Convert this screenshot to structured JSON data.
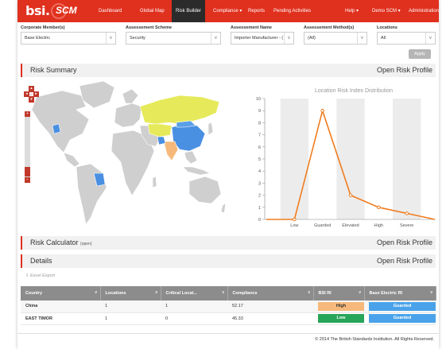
{
  "nav": {
    "logo": "bsi.",
    "product": "SCM",
    "items": [
      "Dashboard",
      "Global Map",
      "Risk Builder",
      "Compliance ▾",
      "Reports",
      "Pending Activities"
    ],
    "right_items": [
      "Help ▾",
      "Demo SCM ▾",
      "Administration ▾"
    ]
  },
  "filters": [
    {
      "label": "Corporate Member(s)",
      "value": "Base Electric"
    },
    {
      "label": "Assessement Scheme",
      "value": "Security"
    },
    {
      "label": "Assessement Name",
      "value": "Importer Manufacturer - ("
    },
    {
      "label": "Assessement Method(s)",
      "value": "(All)"
    },
    {
      "label": "Locations",
      "value": "All"
    }
  ],
  "apply_label": "Apply",
  "sections": {
    "risk_summary": {
      "title": "Risk Summary",
      "link": "Open Risk Profile"
    },
    "risk_calculator": {
      "title": "Risk Calculator",
      "note": "(open)",
      "link": "Open Risk Profile"
    },
    "details": {
      "title": "Details",
      "link": "Open Risk Profile"
    }
  },
  "map_controls": {
    "zoom_in": "+",
    "zoom_out": "−"
  },
  "chart_data": {
    "type": "line",
    "title": "Location Risk Index Distribution",
    "categories": [
      "",
      "Low",
      "Guarded",
      "Elevated",
      "High",
      "Severe",
      ""
    ],
    "values": [
      0,
      0,
      9,
      2,
      1,
      0.5,
      0
    ],
    "ylim": [
      0,
      10
    ],
    "yticks": [
      0,
      1,
      2,
      3,
      4,
      5,
      6,
      7,
      8,
      9,
      10
    ],
    "color": "#f07c1e",
    "band_color": "#ececec"
  },
  "excel_export": "Excel Export",
  "table": {
    "columns": [
      "Country",
      "Locations",
      "Critical Locat...",
      "Compliance",
      "BSI RI",
      "Base Electric RI"
    ],
    "rows": [
      {
        "country": "China",
        "locations": "1",
        "critical": "1",
        "compliance": "52.17",
        "bsi_ri": "High",
        "bsi_color": "#f6b97b",
        "base_ri": "Guarded",
        "base_color": "#4aa3ea"
      },
      {
        "country": "EAST TIMOR",
        "locations": "1",
        "critical": "0",
        "compliance": "45.33",
        "bsi_ri": "Low",
        "bsi_color": "#27a55a",
        "base_ri": "Guarded",
        "base_color": "#4aa3ea"
      }
    ]
  },
  "footer": "© 2014 The British Standards Institution. All Rights Reserved."
}
